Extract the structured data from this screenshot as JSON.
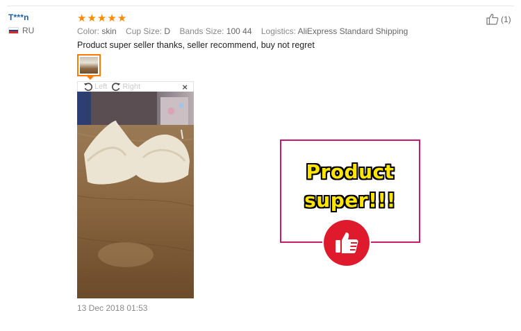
{
  "reviewer": {
    "name": "T***n",
    "country": "RU",
    "flag_colors": [
      "#ffffff",
      "#1c3f9e",
      "#d52b1e"
    ]
  },
  "review": {
    "rating": 5,
    "star_color": "#ff8a00",
    "attributes": [
      {
        "key": "Color:",
        "value": "skin"
      },
      {
        "key": "Cup Size:",
        "value": "D"
      },
      {
        "key": "Bands Size:",
        "value": "100 44"
      },
      {
        "key": "Logistics:",
        "value": "AliExpress Standard Shipping"
      }
    ],
    "text": "Product super seller thanks, seller recommend, buy not regret",
    "date": "13 Dec 2018 01:53"
  },
  "image_viewer": {
    "rotate_left_label": "Left",
    "rotate_right_label": "Right",
    "close_label": "×",
    "photo_subject": "bra on wooden table"
  },
  "helpful": {
    "count_label": "(1)"
  },
  "promo": {
    "line1": "Product",
    "line2": "super!!!",
    "border_color": "#c8196e",
    "badge_color": "#e01a2d",
    "text_color": "#ffe600"
  }
}
